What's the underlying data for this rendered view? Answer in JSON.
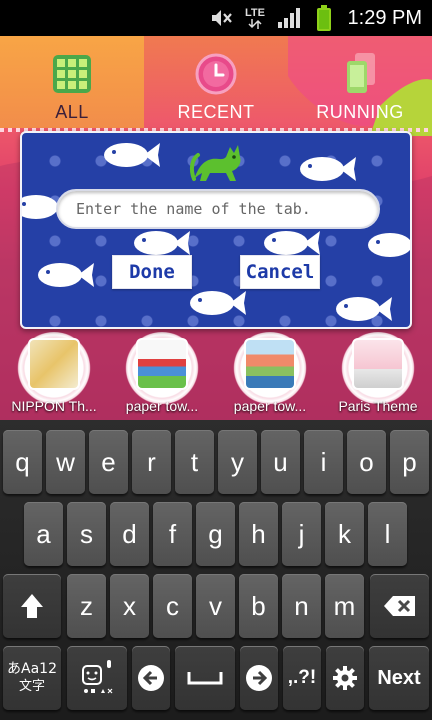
{
  "status_bar": {
    "time": "1:29 PM",
    "network": "LTE",
    "icons": [
      "mute-icon",
      "lte-icon",
      "signal-icon",
      "battery-icon"
    ]
  },
  "tabs": [
    {
      "label": "ALL",
      "icon": "grid-icon",
      "active": true
    },
    {
      "label": "RECENT",
      "icon": "clock-icon",
      "active": false
    },
    {
      "label": "RUNNING",
      "icon": "running-apps-icon",
      "active": false
    }
  ],
  "dialog": {
    "input_placeholder": "Enter the name of the tab.",
    "input_value": "",
    "done_label": "Done",
    "cancel_label": "Cancel",
    "decoration_icons": [
      "cat-icon",
      "fish-icon"
    ]
  },
  "apps": [
    {
      "label": "NIPPON Th..."
    },
    {
      "label": "paper tow..."
    },
    {
      "label": "paper tow..."
    },
    {
      "label": "Paris Theme"
    }
  ],
  "keyboard": {
    "row1": [
      "q",
      "w",
      "e",
      "r",
      "t",
      "y",
      "u",
      "i",
      "o",
      "p"
    ],
    "row2": [
      "a",
      "s",
      "d",
      "f",
      "g",
      "h",
      "j",
      "k",
      "l"
    ],
    "row3": [
      "z",
      "x",
      "c",
      "v",
      "b",
      "n",
      "m"
    ],
    "lang_key_top": "あAa12",
    "lang_key_bottom": "文字",
    "punct_key": ",.?!",
    "next_label": "Next"
  },
  "colors": {
    "dialog_blue": "#2540a6",
    "button_text": "#1d3aa8",
    "active_tab": "#f8a546",
    "keyboard_bg": "#222222"
  }
}
